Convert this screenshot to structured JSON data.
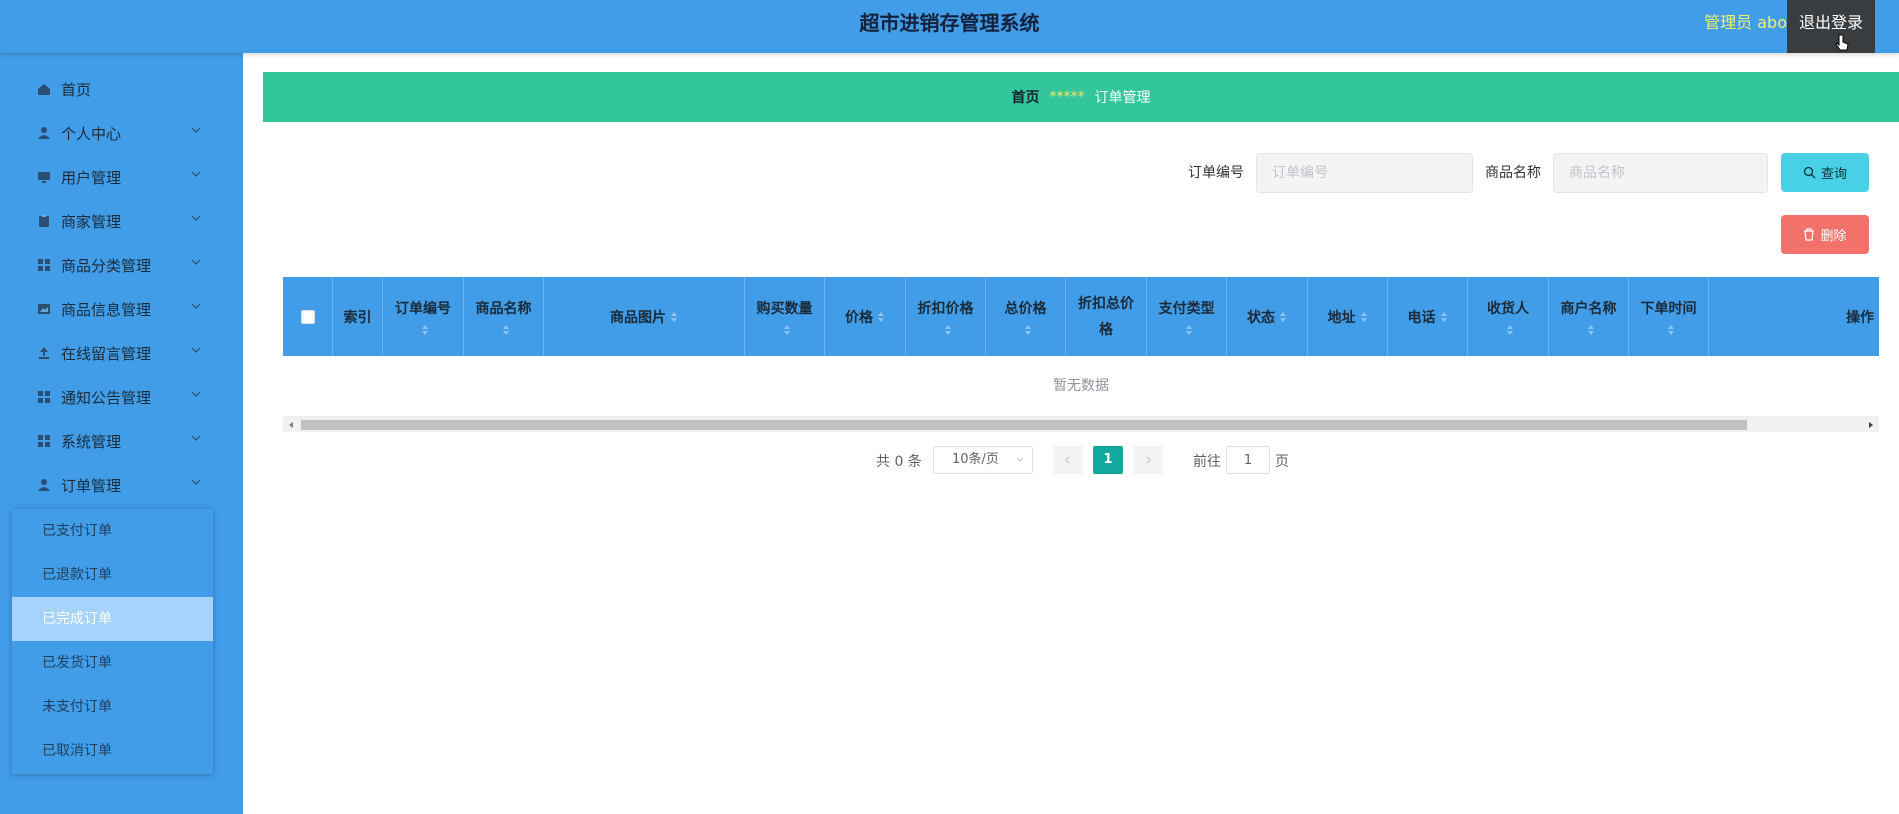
{
  "header": {
    "title": "超市进销存管理系统",
    "user": "管理员 abo",
    "logout": "退出登录"
  },
  "sidebar": {
    "items": [
      {
        "label": "首页",
        "icon": "home-icon"
      },
      {
        "label": "个人中心",
        "icon": "person-icon"
      },
      {
        "label": "用户管理",
        "icon": "monitor-icon"
      },
      {
        "label": "商家管理",
        "icon": "clipboard-icon"
      },
      {
        "label": "商品分类管理",
        "icon": "grid-icon"
      },
      {
        "label": "商品信息管理",
        "icon": "image-icon"
      },
      {
        "label": "在线留言管理",
        "icon": "upload-icon"
      },
      {
        "label": "通知公告管理",
        "icon": "grid-icon"
      },
      {
        "label": "系统管理",
        "icon": "grid-icon"
      },
      {
        "label": "订单管理",
        "icon": "person-icon"
      }
    ],
    "submenu": [
      "已支付订单",
      "已退款订单",
      "已完成订单",
      "已发货订单",
      "未支付订单",
      "已取消订单"
    ],
    "active_submenu": "已完成订单"
  },
  "breadcrumb": {
    "home": "首页",
    "separator": "*****",
    "current": "订单管理"
  },
  "search": {
    "order_no_label": "订单编号",
    "order_no_placeholder": "订单编号",
    "product_name_label": "商品名称",
    "product_name_placeholder": "商品名称",
    "query": "查询",
    "delete": "删除"
  },
  "table": {
    "columns": [
      "索引",
      "订单编号",
      "商品名称",
      "商品图片",
      "购买数量",
      "价格",
      "折扣价格",
      "总价格",
      "折扣总价格",
      "支付类型",
      "状态",
      "地址",
      "电话",
      "收货人",
      "商户名称",
      "下单时间",
      "操作"
    ],
    "empty_text": "暂无数据"
  },
  "pagination": {
    "total": "共 0 条",
    "page_size": "10条/页",
    "current_page": "1",
    "goto_label": "前往",
    "goto_value": "1",
    "page_suffix": "页"
  },
  "colors": {
    "primary": "#419de8",
    "breadcrumb_bg": "#33c69a",
    "query_btn": "#48d0e6",
    "delete_btn": "#f2726b",
    "pager_active": "#13a89e"
  }
}
